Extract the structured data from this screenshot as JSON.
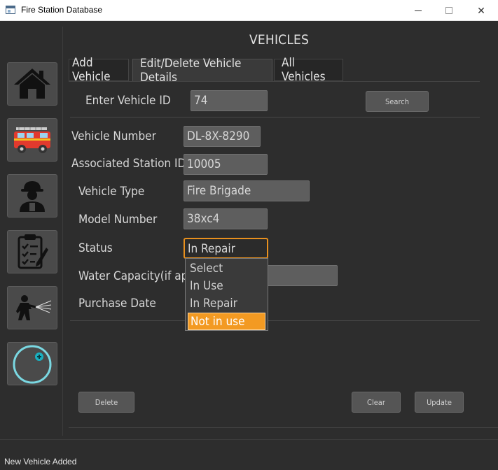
{
  "window": {
    "title": "Fire Station Database"
  },
  "header": {
    "title": "VEHICLES"
  },
  "tabs": [
    {
      "label": "Add Vehicle",
      "active": false
    },
    {
      "label": "Edit/Delete Vehicle Details",
      "active": true
    },
    {
      "label": "All Vehicles",
      "active": false
    }
  ],
  "sidebar": {
    "items": [
      {
        "icon": "home-icon"
      },
      {
        "icon": "fire-truck-icon"
      },
      {
        "icon": "firefighter-icon"
      },
      {
        "icon": "clipboard-icon"
      },
      {
        "icon": "firefighter-hose-icon"
      },
      {
        "icon": "add-circle-icon"
      }
    ]
  },
  "search": {
    "label": "Enter Vehicle ID",
    "value": "74",
    "button": "Search"
  },
  "form": {
    "vehicle_number": {
      "label": "Vehicle Number",
      "value": "DL-8X-8290"
    },
    "station_id": {
      "label": "Associated Station ID",
      "value": "10005"
    },
    "vehicle_type": {
      "label": "Vehicle Type",
      "value": "Fire Brigade"
    },
    "model_number": {
      "label": "Model Number",
      "value": "38xc4"
    },
    "status": {
      "label": "Status",
      "value": "In Repair",
      "options": [
        "Select",
        "In Use",
        "In Repair",
        "Not in use"
      ],
      "highlighted": "Not in use"
    },
    "water_capacity": {
      "label": "Water Capacity(if applicable)",
      "value": ""
    },
    "purchase_date": {
      "label": "Purchase Date",
      "value": ""
    }
  },
  "buttons": {
    "delete": "Delete",
    "clear": "Clear",
    "update": "Update"
  },
  "status_bar": {
    "text": "New Vehicle Added"
  },
  "colors": {
    "accent": "#f39a22",
    "background": "#2d2d2d",
    "field": "#5e5e5e"
  }
}
